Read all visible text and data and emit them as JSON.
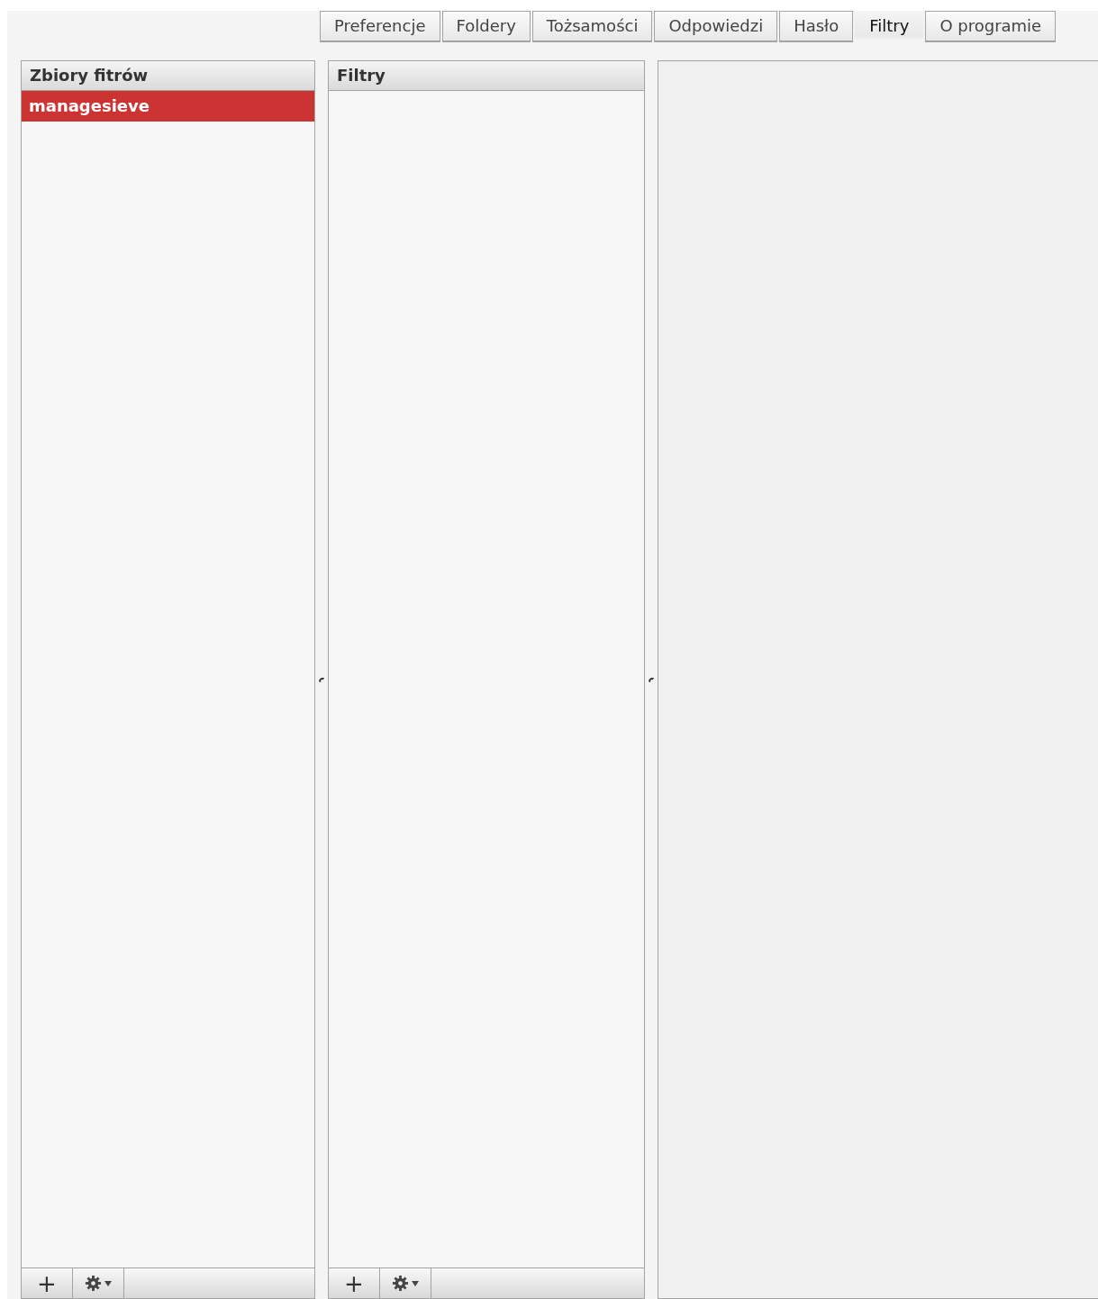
{
  "tabs": [
    {
      "label": "Preferencje",
      "selected": false
    },
    {
      "label": "Foldery",
      "selected": false
    },
    {
      "label": "Tożsamości",
      "selected": false
    },
    {
      "label": "Odpowiedzi",
      "selected": false
    },
    {
      "label": "Hasło",
      "selected": false
    },
    {
      "label": "Filtry",
      "selected": true
    },
    {
      "label": "O programie",
      "selected": false
    }
  ],
  "filter_sets": {
    "title": "Zbiory fitrów",
    "items": [
      {
        "label": "managesieve",
        "selected": true
      }
    ],
    "footer": {
      "add_button": "+"
    }
  },
  "filters": {
    "title": "Filtry",
    "footer": {
      "add_button": "+"
    }
  }
}
